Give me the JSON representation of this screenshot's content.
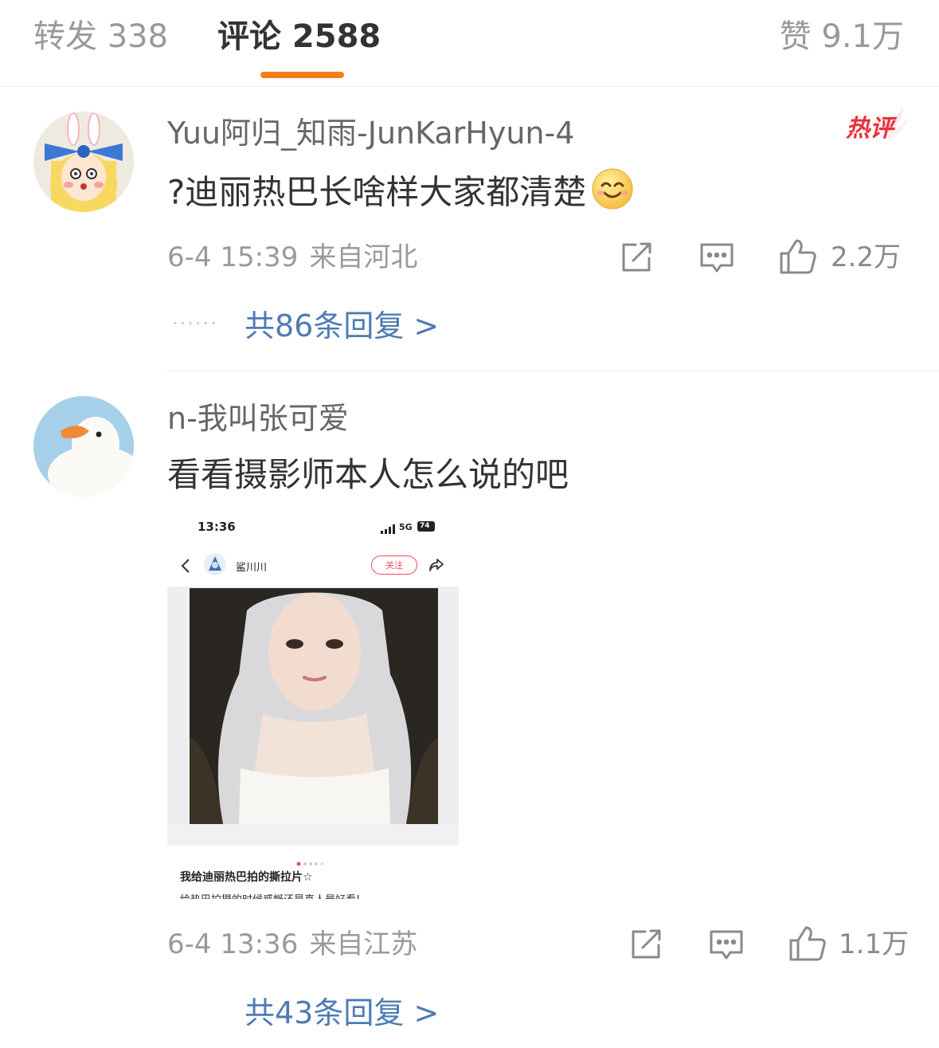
{
  "tabs": {
    "repost": "转发 338",
    "comments": "评论 2588",
    "likes": "赞 9.1万"
  },
  "accent_color": "#f47e18",
  "link_color": "#4d7cb3",
  "comments": [
    {
      "username": "Yuu阿归_知雨-JunKarHyun-4",
      "badge": "热评",
      "text": "?迪丽热巴长啥样大家都清楚",
      "emoji": "smile-emoji",
      "time": "6-4 15:39",
      "location": "来自河北",
      "likes": "2.2万",
      "replies_dots": "······",
      "replies": "共86条回复 >"
    },
    {
      "username": "n-我叫张可爱",
      "text": "看看摄影师本人怎么说的吧",
      "time": "6-4 13:36",
      "location": "来自江苏",
      "likes": "1.1万",
      "replies": "共43条回复 >",
      "attachment": {
        "status_time": "13:36",
        "status_network": "5G",
        "status_battery": "74",
        "author": "鲨川川",
        "follow_label": "关注",
        "post_title": "我给迪丽热巴拍的撕拉片☆",
        "post_text_partial": "给热巴拍摄的时候感慨还是真人最好看!"
      }
    }
  ]
}
